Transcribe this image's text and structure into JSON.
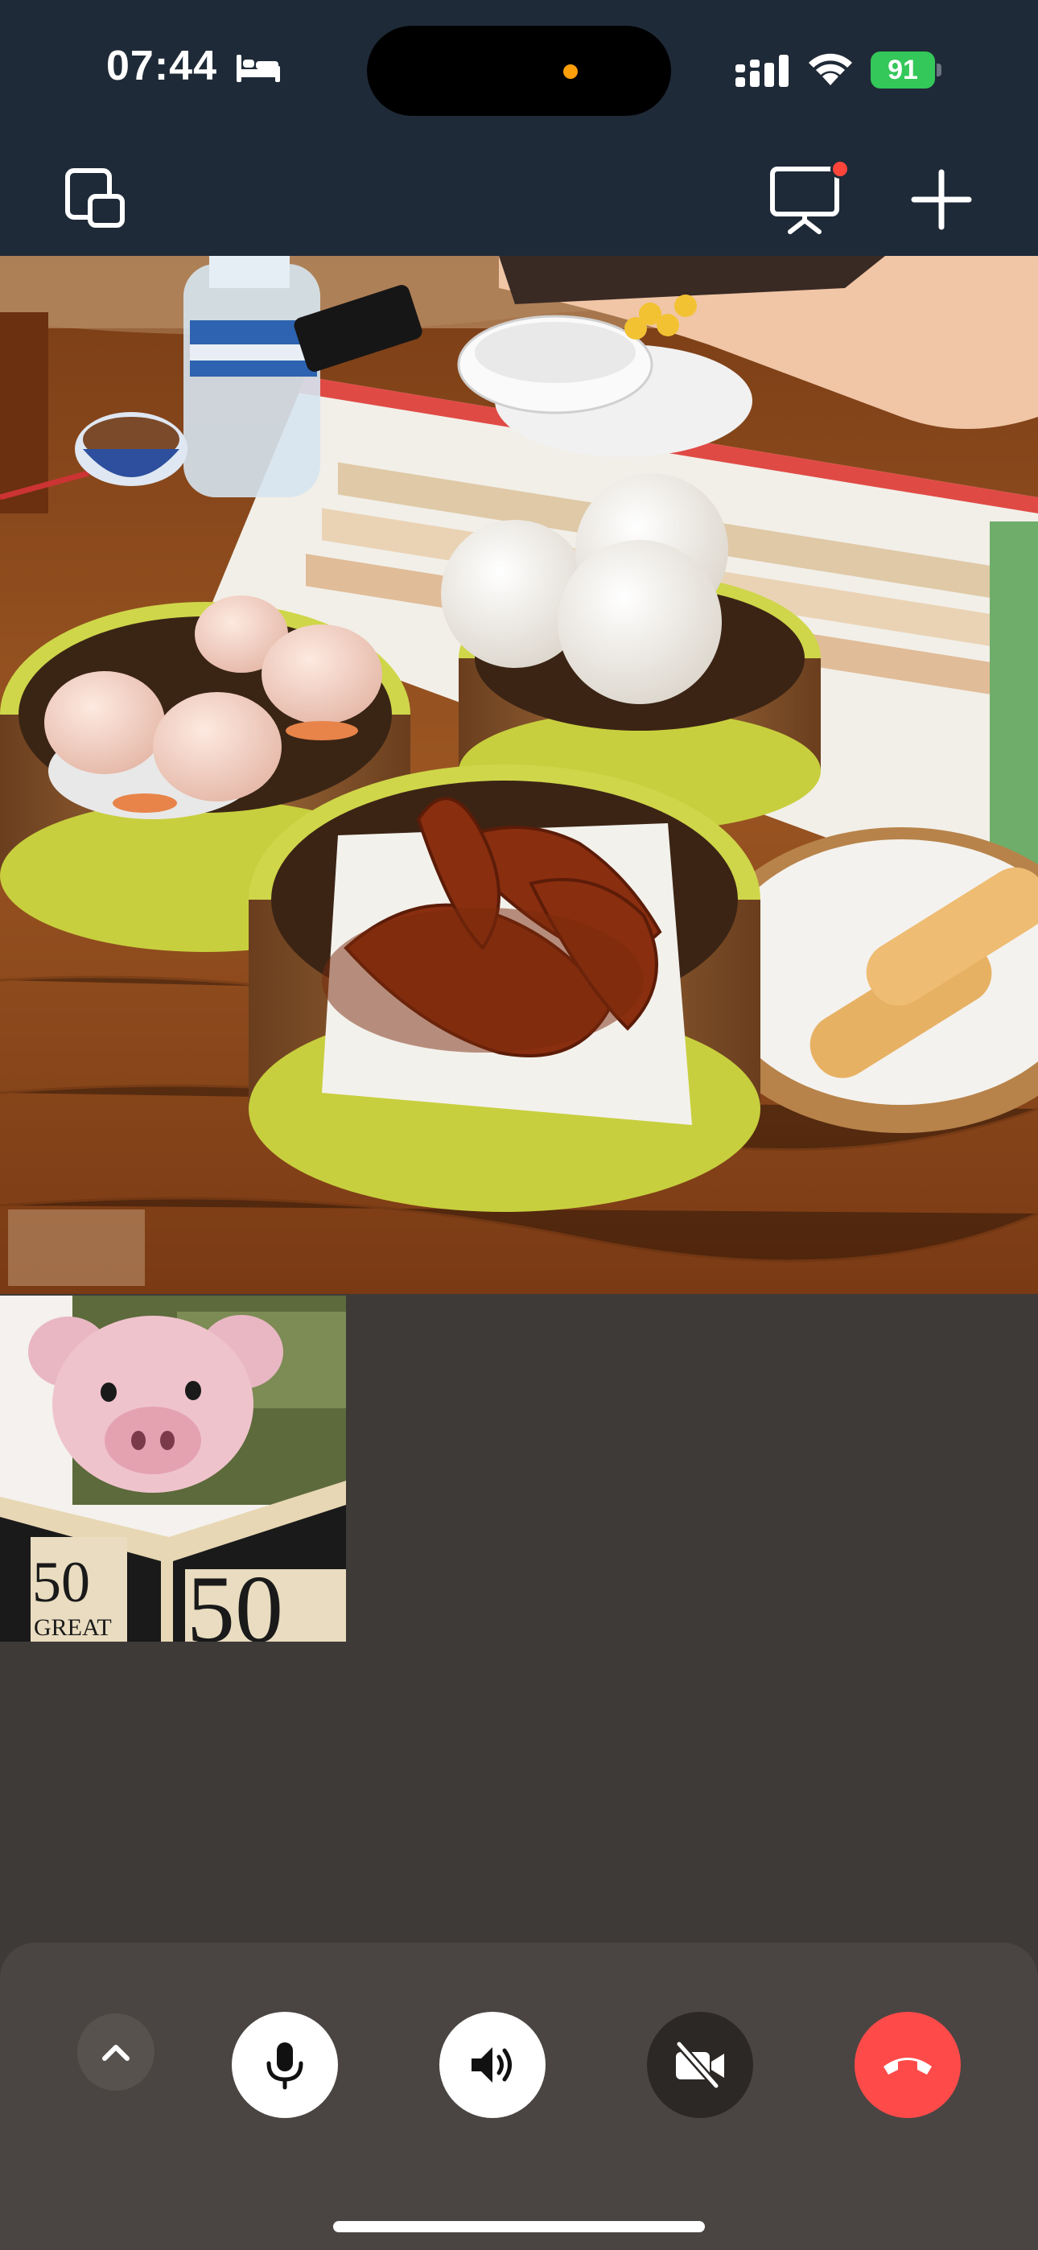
{
  "status_bar": {
    "time": "07:44",
    "battery_percent": "91",
    "icons": [
      "bed-icon",
      "signal-icon",
      "wifi-icon",
      "battery-icon"
    ]
  },
  "header": {
    "icons": [
      "switch-camera-icon",
      "share-screen-icon",
      "add-icon"
    ],
    "share_screen_notification": true
  },
  "remote_video": {
    "book_cover_text": "50"
  },
  "controls": {
    "icons": [
      "chevron-up-icon",
      "microphone-icon",
      "speaker-icon",
      "camera-off-icon",
      "end-call-icon"
    ],
    "colors": {
      "end_call": "#ff4a4a",
      "button_light": "#ffffff",
      "button_dark": "#2b2826",
      "panel": "#4a4542"
    }
  },
  "local_preview": {
    "book_text": "50",
    "book_subtitle": "GREAT"
  },
  "colors": {
    "header_bg": "#1f2a38",
    "battery": "#34c759",
    "privacy_dot": "#ff9f0a",
    "notification_dot": "#ff453a"
  }
}
